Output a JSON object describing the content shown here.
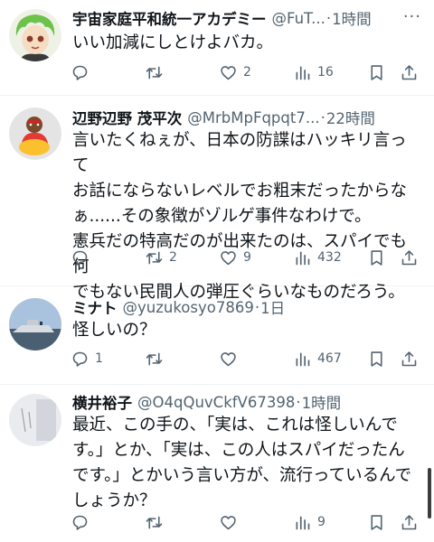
{
  "tweets": [
    {
      "name": "宇宙家庭平和統一アカデミー",
      "handle": "@FuT...",
      "time": "1時間",
      "lines": [
        "いい加減にしとけよバカ。"
      ],
      "replies": "",
      "retweets": "",
      "likes": "2",
      "views": "16",
      "avatar": "anime-character-avatar"
    },
    {
      "name": "辺野辺野 茂平次",
      "handle": "@MrbMpFqpqt7...",
      "time": "22時間",
      "lines": [
        "言いたくねぇが、日本の防諜はハッキリ言って",
        "お話にならないレベルでお粗末だったからな",
        "ぁ......その象徴がゾルゲ事件なわけで。",
        "憲兵だの特高だのが出来たのは、スパイでも何",
        "でもない民間人の弾圧ぐらいなものだろう。"
      ],
      "replies": "",
      "retweets": "2",
      "likes": "9",
      "views": "432",
      "avatar": "figure-avatar"
    },
    {
      "name": "ミナト",
      "handle": "@yuzukosyo7869",
      "time": "1日",
      "lines": [
        "怪しいの？"
      ],
      "replies": "1",
      "retweets": "",
      "likes": "",
      "views": "467",
      "avatar": "ship-photo-avatar"
    },
    {
      "name": "横井裕子",
      "handle": "@O4qQuvCkfV67398",
      "time": "1時間",
      "lines": [
        "最近、この手の、「実は、これは怪しいんで",
        "す。」とか、「実は、この人はスパイだったん",
        "です。」とかいう言い方が、流行っているんで",
        "しょうか？"
      ],
      "replies": "",
      "retweets": "",
      "likes": "",
      "views": "9",
      "avatar": "grey-photo-avatar"
    }
  ],
  "dot_separator": "·",
  "more_glyph": "···",
  "icons": [
    "reply-icon",
    "retweet-icon",
    "like-icon",
    "views-icon",
    "bookmark-icon",
    "share-icon"
  ],
  "colors": {
    "text": "#0f1419",
    "secondary": "#536471",
    "divider": "#eff3f4"
  }
}
